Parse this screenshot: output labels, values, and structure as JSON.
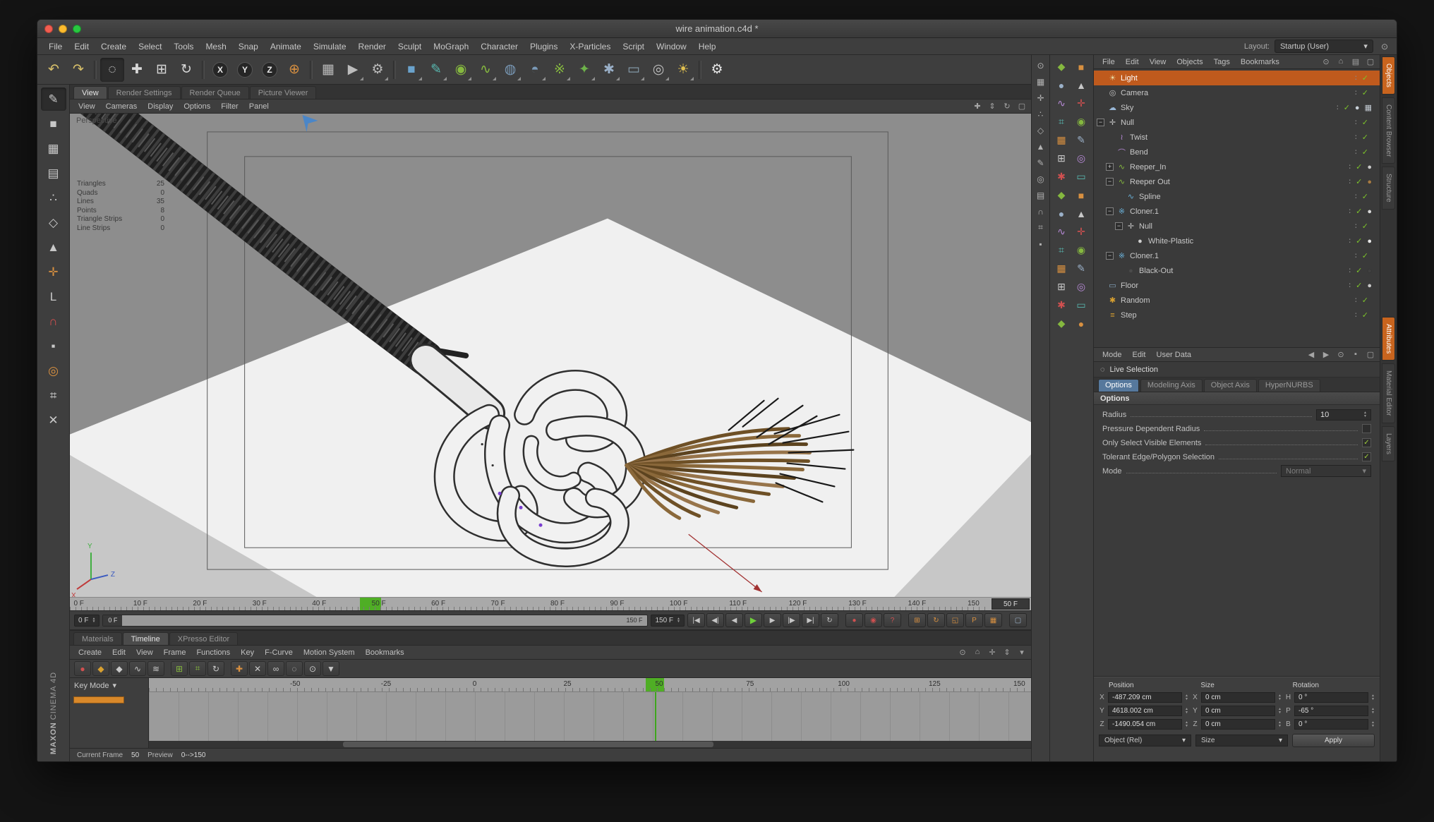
{
  "window": {
    "title": "wire animation.c4d *"
  },
  "ui": {
    "up": "▲",
    "down": "▼",
    "dd": "▾"
  },
  "menubar": {
    "items": [
      "File",
      "Edit",
      "Create",
      "Select",
      "Tools",
      "Mesh",
      "Snap",
      "Animate",
      "Simulate",
      "Render",
      "Sculpt",
      "MoGraph",
      "Character",
      "Plugins",
      "X-Particles",
      "Script",
      "Window",
      "Help"
    ],
    "layout_label": "Layout:",
    "layout_value": "Startup (User)"
  },
  "toolbar": {
    "icons": [
      {
        "n": "undo-button",
        "g": "↶",
        "c": "#d8c06a"
      },
      {
        "n": "redo-button",
        "g": "↷",
        "c": "#d8c06a"
      },
      {
        "sep": true
      },
      {
        "n": "live-selection-tool-button",
        "g": "◌",
        "c": "#e8e8e8",
        "pressed": true
      },
      {
        "n": "move-tool-button",
        "g": "✚",
        "c": "#d8d8d8"
      },
      {
        "n": "scale-tool-button",
        "g": "⊞",
        "c": "#d8d8d8"
      },
      {
        "n": "rotate-tool-button",
        "g": "↻",
        "c": "#d8d8d8"
      },
      {
        "sep": true
      },
      {
        "n": "lock-x-axis-button",
        "g": "X",
        "cls": "axis",
        "c": "#e8e8e8"
      },
      {
        "n": "lock-y-axis-button",
        "g": "Y",
        "cls": "axis",
        "c": "#e8e8e8"
      },
      {
        "n": "lock-z-axis-button",
        "g": "Z",
        "cls": "axis",
        "c": "#e8e8e8"
      },
      {
        "n": "coordinate-system-button",
        "g": "⊕",
        "c": "#d89040"
      },
      {
        "sep": true
      },
      {
        "n": "render-view-button",
        "g": "▦",
        "c": "#bcbcbc"
      },
      {
        "n": "render-picture-viewer-button",
        "g": "▶",
        "c": "#bcbcbc",
        "dd": true
      },
      {
        "n": "render-settings-button",
        "g": "⚙",
        "c": "#bcbcbc",
        "dd": true
      },
      {
        "sep": true
      },
      {
        "n": "add-cube-button",
        "g": "■",
        "c": "#6aa2cc",
        "dd": true
      },
      {
        "n": "add-spline-button",
        "g": "✎",
        "c": "#58b8b0",
        "dd": true
      },
      {
        "n": "add-subdivision-surface-button",
        "g": "◉",
        "c": "#85b83f",
        "dd": true
      },
      {
        "n": "add-sweep-button",
        "g": "∿",
        "c": "#85b83f",
        "dd": true
      },
      {
        "n": "add-metaball-button",
        "g": "◍",
        "c": "#7a9ab8",
        "dd": true
      },
      {
        "n": "add-boole-button",
        "g": "◓",
        "c": "#7a9ab8",
        "dd": true
      },
      {
        "n": "add-cloner-button",
        "g": "※",
        "c": "#85b83f",
        "dd": true
      },
      {
        "n": "add-character-button",
        "g": "✦",
        "c": "#6db24a",
        "dd": true
      },
      {
        "n": "add-particles-button",
        "g": "✱",
        "c": "#9ab0c8",
        "dd": true
      },
      {
        "n": "add-floor-button",
        "g": "▭",
        "c": "#88a0b0",
        "dd": true
      },
      {
        "n": "add-camera-button",
        "g": "◎",
        "c": "#bcbcbc",
        "dd": true
      },
      {
        "n": "add-light-button",
        "g": "☀",
        "c": "#e0c050",
        "dd": true
      },
      {
        "sep": true
      },
      {
        "n": "display-settings-button",
        "g": "⚙",
        "c": "#e8e8e8"
      }
    ]
  },
  "left_toolbar": {
    "icons": [
      {
        "n": "make-editable-button",
        "g": "✎",
        "c": "#c8c8c8",
        "pressed": true
      },
      {
        "n": "model-mode-button",
        "g": "■",
        "c": "#c8c8c8"
      },
      {
        "n": "texture-mode-button",
        "g": "▦",
        "c": "#c8c8c8"
      },
      {
        "n": "workplane-mode-button",
        "g": "▤",
        "c": "#c8c8c8"
      },
      {
        "n": "points-mode-button",
        "g": "∴",
        "c": "#c8c8c8"
      },
      {
        "n": "edges-mode-button",
        "g": "◇",
        "c": "#c8c8c8"
      },
      {
        "n": "polygons-mode-button",
        "g": "▲",
        "c": "#c8c8c8"
      },
      {
        "n": "axis-mode-button",
        "g": "✛",
        "c": "#d89040"
      },
      {
        "n": "coordinates-mode-button",
        "g": "L",
        "c": "#c8c8c8"
      },
      {
        "n": "snap-mode-button",
        "g": "∩",
        "c": "#d85050"
      },
      {
        "n": "lock-workplane-button",
        "g": "▪",
        "c": "#c8c8c8"
      },
      {
        "n": "viewport-solo-button",
        "g": "◎",
        "c": "#d89040"
      },
      {
        "n": "grid-toggle-button",
        "g": "⌗",
        "c": "#c8c8c8"
      },
      {
        "n": "close-tool-button",
        "g": "✕",
        "c": "#c8c8c8"
      }
    ]
  },
  "branding": {
    "line1": "MAXON",
    "line2": "CINEMA 4D"
  },
  "viewport": {
    "tabs": [
      {
        "label": "View",
        "active": true
      },
      {
        "label": "Render Settings"
      },
      {
        "label": "Render Queue"
      },
      {
        "label": "Picture Viewer"
      }
    ],
    "menus": [
      "View",
      "Cameras",
      "Display",
      "Options",
      "Filter",
      "Panel"
    ],
    "corner_icons": [
      {
        "n": "pan-view-icon",
        "g": "✚"
      },
      {
        "n": "zoom-view-icon",
        "g": "⇕"
      },
      {
        "n": "rotate-view-icon",
        "g": "↻"
      },
      {
        "n": "toggle-panel-icon",
        "g": "▢"
      }
    ],
    "camera_label": "Perspective",
    "stats": [
      {
        "label": "Triangles",
        "value": "25"
      },
      {
        "label": "Quads",
        "value": "0"
      },
      {
        "label": "Lines",
        "value": "35"
      },
      {
        "label": "Points",
        "value": "8"
      },
      {
        "label": "Triangle Strips",
        "value": "0"
      },
      {
        "label": "Line Strips",
        "value": "0"
      }
    ],
    "axis": {
      "x": "X",
      "y": "Y",
      "z": "Z"
    },
    "ruler": {
      "labels": [
        {
          "t": "0 F",
          "left": "0.4%"
        },
        {
          "t": "10 F",
          "left": "6.6%"
        },
        {
          "t": "20 F",
          "left": "12.8%"
        },
        {
          "t": "30 F",
          "left": "19%"
        },
        {
          "t": "40 F",
          "left": "25.2%"
        },
        {
          "t": "50 F",
          "left": "31.4%"
        },
        {
          "t": "60 F",
          "left": "37.6%"
        },
        {
          "t": "70 F",
          "left": "43.8%"
        },
        {
          "t": "80 F",
          "left": "50%"
        },
        {
          "t": "90 F",
          "left": "56.2%"
        },
        {
          "t": "100 F",
          "left": "62.4%"
        },
        {
          "t": "110 F",
          "left": "68.6%"
        },
        {
          "t": "120 F",
          "left": "74.8%"
        },
        {
          "t": "130 F",
          "left": "81%"
        },
        {
          "t": "140 F",
          "left": "87.2%"
        },
        {
          "t": "150",
          "left": "93.4%"
        }
      ],
      "current": "50 F"
    }
  },
  "transport": {
    "start_value": "0 F",
    "end_value": "150 F",
    "range_start": "0 F",
    "range_end": "150 F",
    "buttons": [
      {
        "n": "goto-start-button",
        "g": "|◀"
      },
      {
        "n": "prev-key-button",
        "g": "◀|"
      },
      {
        "n": "prev-frame-button",
        "g": "◀"
      },
      {
        "n": "play-button",
        "g": "▶",
        "cls": "play"
      },
      {
        "n": "next-frame-button",
        "g": "▶"
      },
      {
        "n": "next-key-button",
        "g": "|▶"
      },
      {
        "n": "goto-end-button",
        "g": "▶|"
      },
      {
        "n": "loop-mode-button",
        "g": "↻"
      },
      {
        "sep": true
      },
      {
        "n": "record-keyframe-button",
        "g": "●",
        "c": "#d05050"
      },
      {
        "n": "autokeying-button",
        "g": "◉",
        "c": "#d05050"
      },
      {
        "n": "animation-help-button",
        "g": "?",
        "c": "#d05050"
      },
      {
        "sep": true
      },
      {
        "n": "record-position-toggle",
        "g": "⊞",
        "c": "#d89040"
      },
      {
        "n": "record-rotation-toggle",
        "g": "↻",
        "c": "#d89040"
      },
      {
        "n": "record-scale-toggle",
        "g": "◱",
        "c": "#d89040"
      },
      {
        "n": "record-parameter-toggle",
        "g": "P",
        "c": "#d89040"
      },
      {
        "n": "keyframe-selection-button",
        "g": "▦",
        "c": "#d89040"
      },
      {
        "sep": true
      },
      {
        "n": "detach-timeline-button",
        "g": "▢",
        "c": "#9ab0c8"
      }
    ]
  },
  "dopesheet": {
    "tabs": [
      {
        "label": "Materials"
      },
      {
        "label": "Timeline",
        "active": true
      },
      {
        "label": "XPresso Editor"
      }
    ],
    "menus": [
      "Create",
      "Edit",
      "View",
      "Frame",
      "Functions",
      "Key",
      "F-Curve",
      "Motion System",
      "Bookmarks"
    ],
    "menu_icons": [
      {
        "n": "search-icon",
        "g": "⊙"
      },
      {
        "n": "home-icon",
        "g": "⌂"
      },
      {
        "n": "frame-all-icon",
        "g": "✛"
      },
      {
        "n": "scroll-icon",
        "g": "⇕"
      },
      {
        "n": "options-icon",
        "g": "▾"
      }
    ],
    "tools": [
      {
        "n": "record-icon",
        "g": "●",
        "c": "#d05050"
      },
      {
        "n": "keyframe-icon",
        "g": "◆",
        "c": "#d8a030"
      },
      {
        "n": "key-mode-icon",
        "g": "◆",
        "c": "#c8c8c8"
      },
      {
        "n": "fcurve-mode-icon",
        "g": "∿",
        "c": "#c8c8c8"
      },
      {
        "n": "motion-mode-icon",
        "g": "≋",
        "c": "#c8c8c8"
      },
      {
        "sep": true
      },
      {
        "n": "snap-key-icon",
        "g": "⊞",
        "c": "#85b83f"
      },
      {
        "n": "quantize-icon",
        "g": "⌗",
        "c": "#85b83f"
      },
      {
        "n": "loop-icon",
        "g": "↻",
        "c": "#c8c8c8"
      },
      {
        "sep": true
      },
      {
        "n": "add-track-icon",
        "g": "✚",
        "c": "#d89040"
      },
      {
        "n": "delete-track-icon",
        "g": "✕",
        "c": "#c8c8c8"
      },
      {
        "n": "link-keys-icon",
        "g": "∞",
        "c": "#c8c8c8"
      },
      {
        "n": "ghost-keys-icon",
        "g": "◌",
        "c": "#c8c8c8"
      },
      {
        "n": "zoom-keys-icon",
        "g": "⊙",
        "c": "#c8c8c8"
      },
      {
        "n": "filter-icon",
        "g": "▼",
        "c": "#c8c8c8"
      }
    ],
    "key_mode_label": "Key Mode",
    "ruler_labels": [
      {
        "t": "-50",
        "left": "16%"
      },
      {
        "t": "-25",
        "left": "26.3%"
      },
      {
        "t": "0",
        "left": "36.7%"
      },
      {
        "t": "25",
        "left": "47%"
      },
      {
        "t": "50",
        "left": "57.4%"
      },
      {
        "t": "75",
        "left": "67.7%"
      },
      {
        "t": "100",
        "left": "78.1%"
      },
      {
        "t": "125",
        "left": "88.4%"
      },
      {
        "t": "150",
        "left": "98%"
      }
    ],
    "status": {
      "frame_label": "Current Frame",
      "frame_value": "50",
      "preview_label": "Preview",
      "preview_value": "0-->150"
    }
  },
  "slim_palette": {
    "icons": [
      {
        "g": "⊙"
      },
      {
        "g": "▦"
      },
      {
        "g": "✛"
      },
      {
        "g": "∴"
      },
      {
        "g": "◇"
      },
      {
        "g": "▲"
      },
      {
        "g": "✎"
      },
      {
        "g": "◎"
      },
      {
        "g": "▤"
      },
      {
        "g": "∩"
      },
      {
        "g": "⌗"
      },
      {
        "g": "▪"
      }
    ]
  },
  "command_palette": {
    "icons": [
      {
        "g": "◆",
        "c": "#85b83f"
      },
      {
        "g": "■",
        "c": "#d89040"
      },
      {
        "g": "●",
        "c": "#9ab0c8"
      },
      {
        "g": "▲",
        "c": "#c8c8c8"
      },
      {
        "g": "∿",
        "c": "#b88ad8"
      },
      {
        "g": "✛",
        "c": "#d05050"
      },
      {
        "g": "⌗",
        "c": "#58b8b0"
      },
      {
        "g": "◉",
        "c": "#85b83f"
      },
      {
        "g": "▦",
        "c": "#d89040"
      },
      {
        "g": "✎",
        "c": "#9ab0c8"
      },
      {
        "g": "⊞",
        "c": "#c8c8c8"
      },
      {
        "g": "◎",
        "c": "#b88ad8"
      },
      {
        "g": "✱",
        "c": "#d05050"
      },
      {
        "g": "▭",
        "c": "#58b8b0"
      },
      {
        "g": "◆",
        "c": "#85b83f"
      },
      {
        "g": "■",
        "c": "#d89040"
      },
      {
        "g": "●",
        "c": "#9ab0c8"
      },
      {
        "g": "▲",
        "c": "#c8c8c8"
      },
      {
        "g": "∿",
        "c": "#b88ad8"
      },
      {
        "g": "✛",
        "c": "#d05050"
      },
      {
        "g": "⌗",
        "c": "#58b8b0"
      },
      {
        "g": "◉",
        "c": "#85b83f"
      },
      {
        "g": "▦",
        "c": "#d89040"
      },
      {
        "g": "✎",
        "c": "#9ab0c8"
      },
      {
        "g": "⊞",
        "c": "#c8c8c8"
      },
      {
        "g": "◎",
        "c": "#b88ad8"
      },
      {
        "g": "✱",
        "c": "#d05050"
      },
      {
        "g": "▭",
        "c": "#58b8b0"
      },
      {
        "g": "◆",
        "c": "#85b83f"
      },
      {
        "g": "●",
        "c": "#d89040"
      }
    ]
  },
  "object_manager": {
    "menus": [
      "File",
      "Edit",
      "View",
      "Objects",
      "Tags",
      "Bookmarks"
    ],
    "menu_icons": [
      {
        "n": "search-icon",
        "g": "⊙"
      },
      {
        "n": "home-icon",
        "g": "⌂"
      },
      {
        "n": "layout-icon",
        "g": "▤"
      },
      {
        "n": "panel-icon",
        "g": "▢"
      }
    ],
    "decor": {
      "dots": "∶",
      "check": "✓"
    },
    "items": [
      {
        "n": "tree-item-light",
        "label": "Light",
        "g": "☀",
        "c": "#e8d8a0",
        "sel": true
      },
      {
        "n": "tree-item-camera",
        "label": "Camera",
        "g": "◎",
        "c": "#c0c0c0"
      },
      {
        "n": "tree-item-sky",
        "label": "Sky",
        "g": "☁",
        "c": "#9ab8d8",
        "tag": "● ▦",
        "tc": "#c8d0d8"
      },
      {
        "n": "tree-item-null",
        "label": "Null",
        "g": "✛",
        "c": "#c0c0c0",
        "exp": "−"
      },
      {
        "n": "tree-item-twist",
        "label": "Twist",
        "g": "≀",
        "c": "#b88ad8",
        "indent": 1
      },
      {
        "n": "tree-item-bend",
        "label": "Bend",
        "g": "⌒",
        "c": "#b88ad8",
        "indent": 1
      },
      {
        "n": "tree-item-reeper-in",
        "label": "Reeper_In",
        "g": "∿",
        "c": "#85b83f",
        "indent": 1,
        "exp": "+",
        "tag": "●",
        "tc": "#c8c8c8"
      },
      {
        "n": "tree-item-reeper-out",
        "label": "Reeper Out",
        "g": "∿",
        "c": "#85b83f",
        "indent": 1,
        "exp": "−",
        "tag": "●",
        "tc": "#a67a42"
      },
      {
        "n": "tree-item-spline",
        "label": "Spline",
        "g": "∿",
        "c": "#6ab0d8",
        "indent": 2
      },
      {
        "n": "tree-item-cloner-1",
        "label": "Cloner.1",
        "g": "※",
        "c": "#6ab0d8",
        "indent": 1,
        "exp": "−",
        "tag": "●",
        "tc": "#d8d8d8"
      },
      {
        "n": "tree-item-null-2",
        "label": "Null",
        "g": "✛",
        "c": "#c0c0c0",
        "indent": 2,
        "exp": "−"
      },
      {
        "n": "tree-item-white-plastic",
        "label": "White-Plastic",
        "g": "●",
        "c": "#d0d0d0",
        "indent": 3,
        "tag": "●",
        "tc": "#e8e8e8"
      },
      {
        "n": "tree-item-cloner-2",
        "label": "Cloner.1",
        "g": "※",
        "c": "#6ab0d8",
        "indent": 1,
        "exp": "−"
      },
      {
        "n": "tree-item-black-out",
        "label": "Black-Out",
        "g": "●",
        "c": "#4a4a4a",
        "indent": 2,
        "tag": "●",
        "tc": "#404040"
      },
      {
        "n": "tree-item-floor",
        "label": "Floor",
        "g": "▭",
        "c": "#88a8c0",
        "tag": "●",
        "tc": "#c8c8c8"
      },
      {
        "n": "tree-item-random",
        "label": "Random",
        "g": "✱",
        "c": "#d8a030"
      },
      {
        "n": "tree-item-step",
        "label": "Step",
        "g": "≡",
        "c": "#d8a030"
      }
    ]
  },
  "attributes": {
    "menus": [
      "Mode",
      "Edit",
      "User Data"
    ],
    "menu_icons": [
      {
        "n": "back-icon",
        "g": "◀"
      },
      {
        "n": "forward-icon",
        "g": "▶"
      },
      {
        "n": "search-icon",
        "g": "⊙"
      },
      {
        "n": "lock-icon",
        "g": "▪"
      },
      {
        "n": "panel-icon",
        "g": "▢"
      }
    ],
    "title_icon": "◌",
    "title": "Live Selection",
    "tabs": [
      {
        "label": "Options",
        "active": true
      },
      {
        "label": "Modeling Axis"
      },
      {
        "label": "Object Axis"
      },
      {
        "label": "HyperNURBS"
      }
    ],
    "section": "Options",
    "check_glyph": "✓",
    "rows": [
      {
        "n": "radius-field",
        "label": "Radius",
        "kind": "value",
        "value": "10"
      },
      {
        "n": "pressure-dependent-radius-checkbox",
        "label": "Pressure Dependent Radius",
        "kind": "check"
      },
      {
        "n": "only-select-visible-checkbox",
        "label": "Only Select Visible Elements",
        "kind": "check",
        "checked": true
      },
      {
        "n": "tolerant-edge-polygon-checkbox",
        "label": "Tolerant Edge/Polygon Selection",
        "kind": "check",
        "checked": true
      },
      {
        "n": "mode-select",
        "label": "Mode",
        "kind": "select",
        "value": "Normal",
        "disabled": true
      }
    ]
  },
  "coords": {
    "headers": [
      "Position",
      "Size",
      "Rotation"
    ],
    "rows": [
      {
        "pl": "X",
        "pv": "-487.209 cm",
        "sl": "X",
        "sv": "0 cm",
        "rl": "H",
        "rv": "0 °"
      },
      {
        "pl": "Y",
        "pv": "4618.002 cm",
        "sl": "Y",
        "sv": "0 cm",
        "rl": "P",
        "rv": "-65 °"
      },
      {
        "pl": "Z",
        "pv": "-1490.054 cm",
        "sl": "Z",
        "sv": "0 cm",
        "rl": "B",
        "rv": "0 °"
      }
    ],
    "mode_select": "Object (Rel)",
    "size_select": "Size",
    "apply_label": "Apply"
  },
  "far_tabs": {
    "top": [
      {
        "label": "Objects",
        "active": true
      },
      {
        "label": "Content Browser"
      },
      {
        "label": "Structure"
      }
    ],
    "bottom": [
      {
        "label": "Attributes",
        "active": true
      },
      {
        "label": "Material Editor"
      },
      {
        "label": "Layers"
      }
    ]
  }
}
